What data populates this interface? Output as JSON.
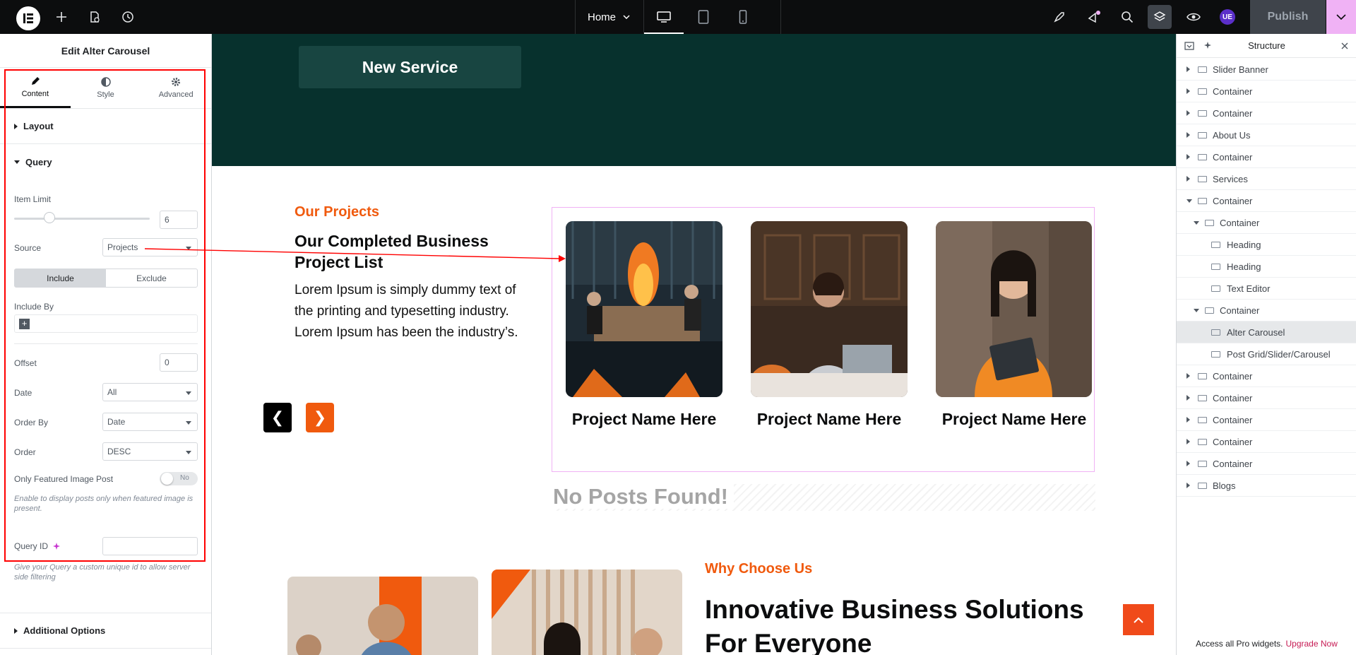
{
  "topbar": {
    "page_select": "Home",
    "user_badge": "UE",
    "publish_label": "Publish"
  },
  "panel": {
    "title": "Edit Alter Carousel",
    "tabs": [
      {
        "label": "Content",
        "icon": "pencil-icon"
      },
      {
        "label": "Style",
        "icon": "half-circle-icon"
      },
      {
        "label": "Advanced",
        "icon": "gear-icon"
      }
    ],
    "sections": {
      "layout": "Layout",
      "query": "Query",
      "additional": "Additional Options"
    },
    "query": {
      "item_limit_label": "Item Limit",
      "item_limit_value": "6",
      "source_label": "Source",
      "source_value": "Projects",
      "include_label": "Include",
      "exclude_label": "Exclude",
      "include_by_label": "Include By",
      "offset_label": "Offset",
      "offset_value": "0",
      "date_label": "Date",
      "date_value": "All",
      "order_by_label": "Order By",
      "order_by_value": "Date",
      "order_label": "Order",
      "order_value": "DESC",
      "featured_label": "Only Featured Image Post",
      "featured_toggle": "No",
      "featured_help": "Enable to display posts only when featured image is present.",
      "query_id_label": "Query ID",
      "query_id_help": "Give your Query a custom unique id to allow server side filtering"
    }
  },
  "canvas": {
    "hero_button": "New Service",
    "projects_eyebrow": "Our Projects",
    "projects_heading_line1": "Our Completed Business",
    "projects_heading_line2": "Project List",
    "projects_text": "Lorem Ipsum is simply dummy text of the printing and typesetting industry. Lorem Ipsum has been the industry’s.",
    "prev": "❮",
    "next": "❯",
    "cards": [
      {
        "title": "Project Name Here"
      },
      {
        "title": "Project Name Here"
      },
      {
        "title": "Project Name Here"
      }
    ],
    "no_posts": "No Posts Found!",
    "why_eyebrow": "Why Choose Us",
    "why_heading_line1": "Innovative Business Solutions",
    "why_heading_line2": "For Everyone"
  },
  "structure": {
    "title": "Structure",
    "items": [
      {
        "label": "Slider Banner",
        "caret": "right",
        "indent": 0
      },
      {
        "label": "Container",
        "caret": "right",
        "indent": 0
      },
      {
        "label": "Container",
        "caret": "right",
        "indent": 0
      },
      {
        "label": "About Us",
        "caret": "right",
        "indent": 0
      },
      {
        "label": "Container",
        "caret": "right",
        "indent": 0
      },
      {
        "label": "Services",
        "caret": "right",
        "indent": 0
      },
      {
        "label": "Container",
        "caret": "down",
        "indent": 0
      },
      {
        "label": "Container",
        "caret": "down",
        "indent": 1
      },
      {
        "label": "Heading",
        "caret": "none",
        "indent": 2
      },
      {
        "label": "Heading",
        "caret": "none",
        "indent": 2
      },
      {
        "label": "Text Editor",
        "caret": "none",
        "indent": 2
      },
      {
        "label": "Container",
        "caret": "down",
        "indent": 1
      },
      {
        "label": "Alter Carousel",
        "caret": "none",
        "indent": 2,
        "selected": true
      },
      {
        "label": "Post Grid/Slider/Carousel",
        "caret": "none",
        "indent": 2
      },
      {
        "label": "Container",
        "caret": "right",
        "indent": 0
      },
      {
        "label": "Container",
        "caret": "right",
        "indent": 0
      },
      {
        "label": "Container",
        "caret": "right",
        "indent": 0
      },
      {
        "label": "Container",
        "caret": "right",
        "indent": 0
      },
      {
        "label": "Container",
        "caret": "right",
        "indent": 0
      },
      {
        "label": "Blogs",
        "caret": "right",
        "indent": 0
      }
    ],
    "footer_text": "Access all Pro widgets.",
    "footer_link": "Upgrade Now"
  },
  "colors": {
    "accent_orange": "#f05a0e",
    "hero_bg": "#07312d",
    "annotation_red": "#ff0000",
    "selection_pink": "#f0b2f5"
  }
}
